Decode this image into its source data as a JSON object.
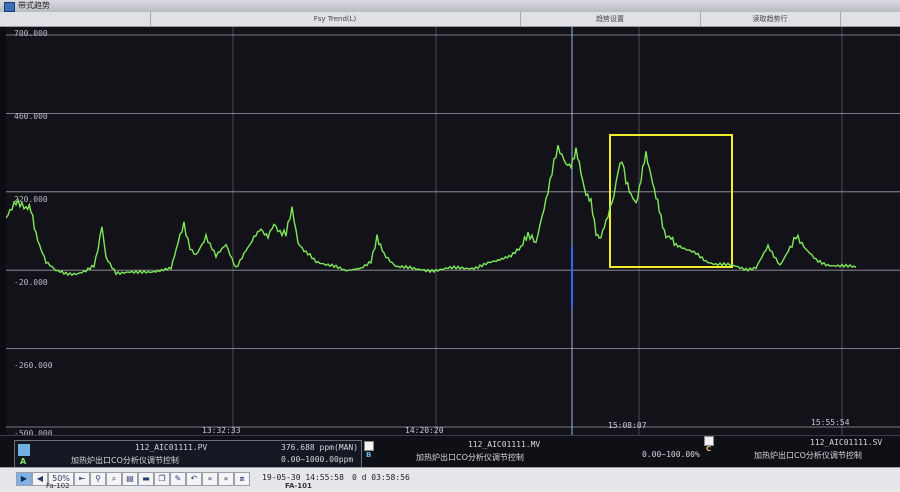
{
  "window": {
    "title": "带式趋势",
    "toolbar": [
      "Fsy Trend(L)",
      "趋势设置",
      "读取趋势行"
    ]
  },
  "plot": {
    "y_ticks": [
      "700.000",
      "460.000",
      "220.000",
      "-20.000",
      "-260.000",
      "-500.000"
    ],
    "x_ticks": [
      "13:32:33",
      "14:20:20",
      "15:08:07",
      "15:55:54"
    ],
    "line_color": "#7ee85a",
    "highlight_color": "#f2ec2a"
  },
  "legend": {
    "A": {
      "letter": "A",
      "tag": "112_AIC01111.PV",
      "desc": "加热炉出口CO分析仪调节控制",
      "value": "376.688 ppm(MAN)",
      "range": "0.00~1000.00ppm"
    },
    "B": {
      "letter": "B",
      "tag": "112_AIC01111.MV",
      "desc": "加热炉出口CO分析仪调节控制",
      "range": "0.00~100.00%"
    },
    "C": {
      "letter": "C",
      "tag": "112_AIC01111.SV",
      "desc": "加热炉出口CO分析仪调节控制"
    }
  },
  "bottombar": {
    "zoom": "50%",
    "start_time": "19-05-30 14:55:58",
    "span": "0 d 03:58:56",
    "status_left": "Fa-102",
    "status_mid": "FA-101"
  },
  "chart_data": {
    "type": "line",
    "ylim": [
      -500,
      700
    ],
    "y_ticks": [
      700,
      460,
      220,
      -20,
      -260,
      -500
    ],
    "x_ticks": [
      "13:32:33",
      "14:20:20",
      "15:08:07",
      "15:55:54"
    ],
    "series": [
      {
        "name": "112_AIC01111.PV",
        "x": [
          0,
          10,
          20,
          25,
          30,
          35,
          40,
          50,
          60,
          70,
          80,
          88,
          92,
          96,
          100,
          110,
          130,
          150,
          165,
          172,
          178,
          184,
          190,
          200,
          210,
          220,
          230,
          240,
          248,
          255,
          262,
          268,
          274,
          280,
          286,
          292,
          298,
          304,
          310,
          320,
          340,
          355,
          365,
          371,
          378,
          390,
          410,
          430,
          450,
          470,
          490,
          505,
          515,
          522,
          530,
          540,
          548,
          552,
          556,
          560,
          565,
          570,
          575,
          580,
          585,
          590,
          595,
          600,
          604,
          608,
          612,
          616,
          620,
          625,
          630,
          635,
          640,
          645,
          650,
          655,
          660,
          665,
          670,
          680,
          690,
          700,
          710,
          720,
          730,
          740,
          750,
          756,
          762,
          768,
          774,
          780,
          790,
          800,
          810,
          820,
          830,
          840,
          850
        ],
        "y": [
          140,
          180,
          170,
          160,
          100,
          40,
          5,
          -25,
          -30,
          -28,
          -22,
          -10,
          40,
          110,
          20,
          -25,
          -30,
          -20,
          -10,
          60,
          120,
          50,
          30,
          80,
          20,
          60,
          -10,
          40,
          70,
          110,
          90,
          130,
          100,
          90,
          160,
          60,
          40,
          30,
          10,
          -5,
          -20,
          -15,
          10,
          90,
          30,
          -5,
          -20,
          -18,
          -15,
          -10,
          5,
          20,
          50,
          80,
          60,
          200,
          320,
          360,
          330,
          300,
          310,
          340,
          280,
          220,
          180,
          100,
          80,
          120,
          160,
          200,
          280,
          320,
          260,
          200,
          190,
          260,
          330,
          280,
          200,
          140,
          90,
          70,
          60,
          40,
          30,
          10,
          0,
          -5,
          -10,
          -15,
          -10,
          20,
          50,
          20,
          -5,
          30,
          90,
          40,
          10,
          0,
          -5,
          -10,
          -12
        ]
      }
    ]
  }
}
